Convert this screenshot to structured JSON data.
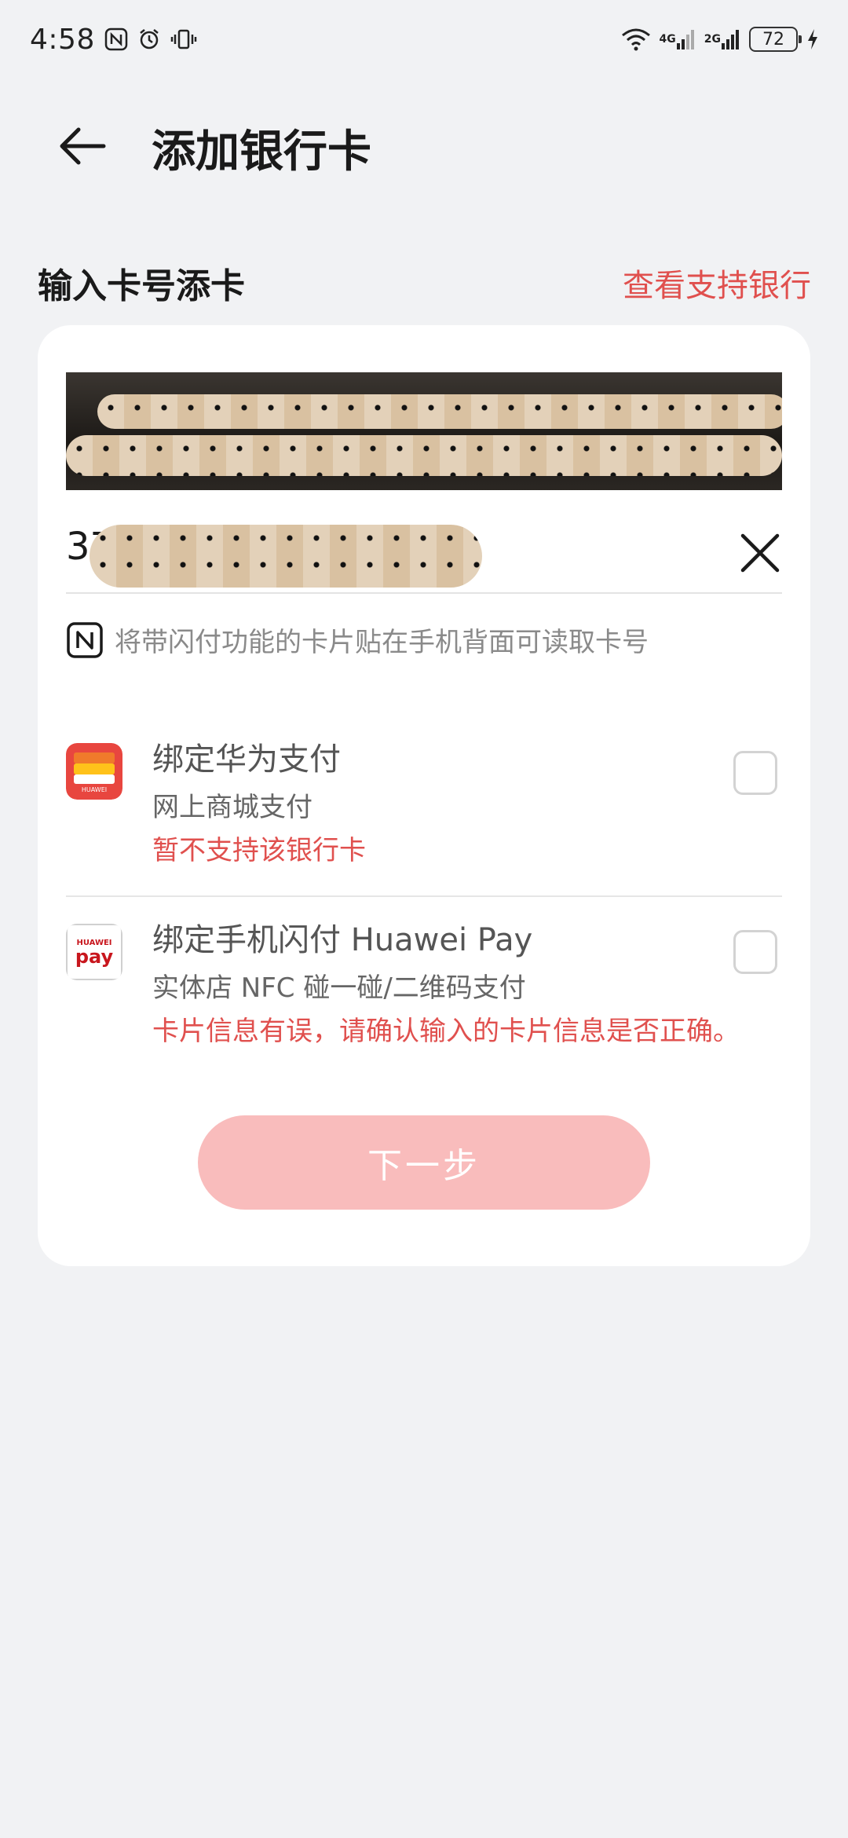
{
  "status_bar": {
    "time": "4:58",
    "network_1": "4G",
    "network_2": "2G",
    "battery": "72"
  },
  "header": {
    "title": "添加银行卡"
  },
  "section": {
    "title": "输入卡号添卡",
    "link": "查看支持银行"
  },
  "card_input": {
    "value_visible": "37",
    "nfc_hint": "将带闪付功能的卡片贴在手机背面可读取卡号"
  },
  "options": [
    {
      "title": "绑定华为支付",
      "subtitle": "网上商城支付",
      "error": "暂不支持该银行卡",
      "checked": false
    },
    {
      "title": "绑定手机闪付 Huawei Pay",
      "subtitle": "实体店 NFC 碰一碰/二维码支付",
      "error": "卡片信息有误，请确认输入的卡片信息是否正确。",
      "checked": false
    }
  ],
  "next_button": {
    "label": "下一步"
  },
  "colors": {
    "accent": "#e0504e",
    "button_disabled": "#f9bcbc",
    "background": "#f1f2f4",
    "card": "#ffffff"
  },
  "icons": [
    "back-arrow-icon",
    "nfc-icon",
    "alarm-icon",
    "vibrate-icon",
    "wifi-icon",
    "signal-icon",
    "battery-icon",
    "charging-icon",
    "close-icon",
    "huawei-pay-logo"
  ]
}
